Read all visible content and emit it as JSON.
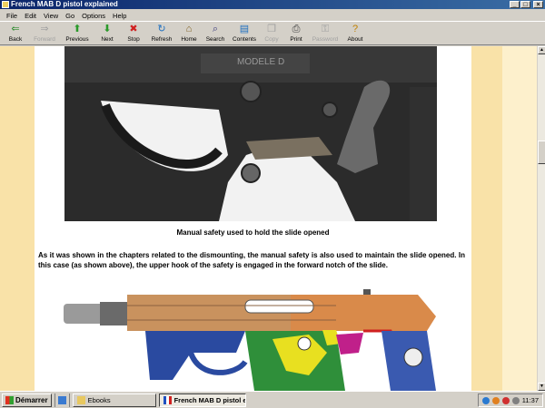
{
  "window": {
    "title": "French MAB D pistol explained"
  },
  "window_controls": {
    "minimize": "_",
    "maximize": "□",
    "close": "×"
  },
  "menu": [
    "File",
    "Edit",
    "View",
    "Go",
    "Options",
    "Help"
  ],
  "toolbar": [
    {
      "label": "Back",
      "icon": "back-arrow-icon",
      "glyph": "⇐",
      "color": "#2a8a2a",
      "enabled": true
    },
    {
      "label": "Forward",
      "icon": "forward-arrow-icon",
      "glyph": "⇒",
      "color": "#a0a0a0",
      "enabled": false
    },
    {
      "label": "Previous",
      "icon": "up-arrow-icon",
      "glyph": "⬆",
      "color": "#2a9a2a",
      "enabled": true
    },
    {
      "label": "Next",
      "icon": "down-arrow-icon",
      "glyph": "⬇",
      "color": "#2a9a2a",
      "enabled": true
    },
    {
      "label": "Stop",
      "icon": "stop-icon",
      "glyph": "✖",
      "color": "#d02020",
      "enabled": true
    },
    {
      "label": "Refresh",
      "icon": "refresh-icon",
      "glyph": "↻",
      "color": "#2070c0",
      "enabled": true
    },
    {
      "label": "Home",
      "icon": "home-icon",
      "glyph": "⌂",
      "color": "#806020",
      "enabled": true
    },
    {
      "label": "Search",
      "icon": "search-icon",
      "glyph": "⌕",
      "color": "#404080",
      "enabled": true
    },
    {
      "label": "Contents",
      "icon": "contents-icon",
      "glyph": "▤",
      "color": "#2070c0",
      "enabled": true
    },
    {
      "label": "Copy",
      "icon": "copy-icon",
      "glyph": "❐",
      "color": "#a0a0a0",
      "enabled": false
    },
    {
      "label": "Print",
      "icon": "print-icon",
      "glyph": "⎙",
      "color": "#404040",
      "enabled": true
    },
    {
      "label": "Password",
      "icon": "key-icon",
      "glyph": "⚿",
      "color": "#a0a0a0",
      "enabled": false
    },
    {
      "label": "About",
      "icon": "about-icon",
      "glyph": "?",
      "color": "#c08000",
      "enabled": true
    }
  ],
  "page": {
    "caption": "Manual safety used to hold the slide opened",
    "paragraph": "As it was shown in the chapters related to the dismounting, the manual safety is also used to maintain the slide opened. In this case (as shown above), the upper hook of the safety is engaged in the forward notch of the slide.",
    "photo_stamp": "MODELE D"
  },
  "taskbar": {
    "start": "Démarrer",
    "tasks": [
      {
        "label": "Ebooks",
        "icon": "folder-icon",
        "active": false
      },
      {
        "label": "French MAB D pistol e...",
        "icon": "book-icon",
        "active": true
      }
    ],
    "clock": "11:37"
  },
  "colors": {
    "margin": "#f9e2a8",
    "title_bar": "#0a246a"
  }
}
